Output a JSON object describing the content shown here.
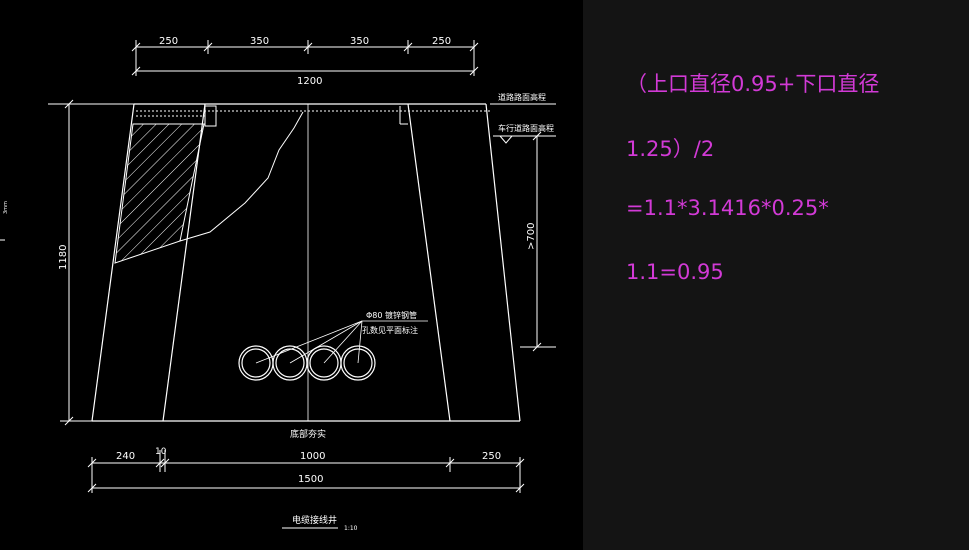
{
  "drawing": {
    "top_dims": [
      "250",
      "350",
      "350",
      "250"
    ],
    "top_total": "1200",
    "left_height": "1180",
    "right_height": ">700",
    "label_road_top": "道路路面高程",
    "label_sidewalk": "车行道路面高程",
    "pipe_note_1": "Φ80 镀锌钢管",
    "pipe_note_2": "孔数见平面标注",
    "base_label": "底部夯实",
    "bottom_dims": [
      "240",
      "10",
      "1000",
      "250"
    ],
    "bottom_total": "1500",
    "title": "电缆接线井",
    "scale": "1:10",
    "tiny_left_label": "3mm"
  },
  "notes": {
    "line1": "（上口直径0.95+下口直径",
    "line2": "1.25）/2",
    "line3": "=1.1*3.1416*0.25*",
    "line4": "1.1=0.95"
  },
  "colors": {
    "canvas_bg": "#000000",
    "panel_bg": "#141414",
    "line": "#ffffff",
    "note_text": "#d23ad6"
  }
}
